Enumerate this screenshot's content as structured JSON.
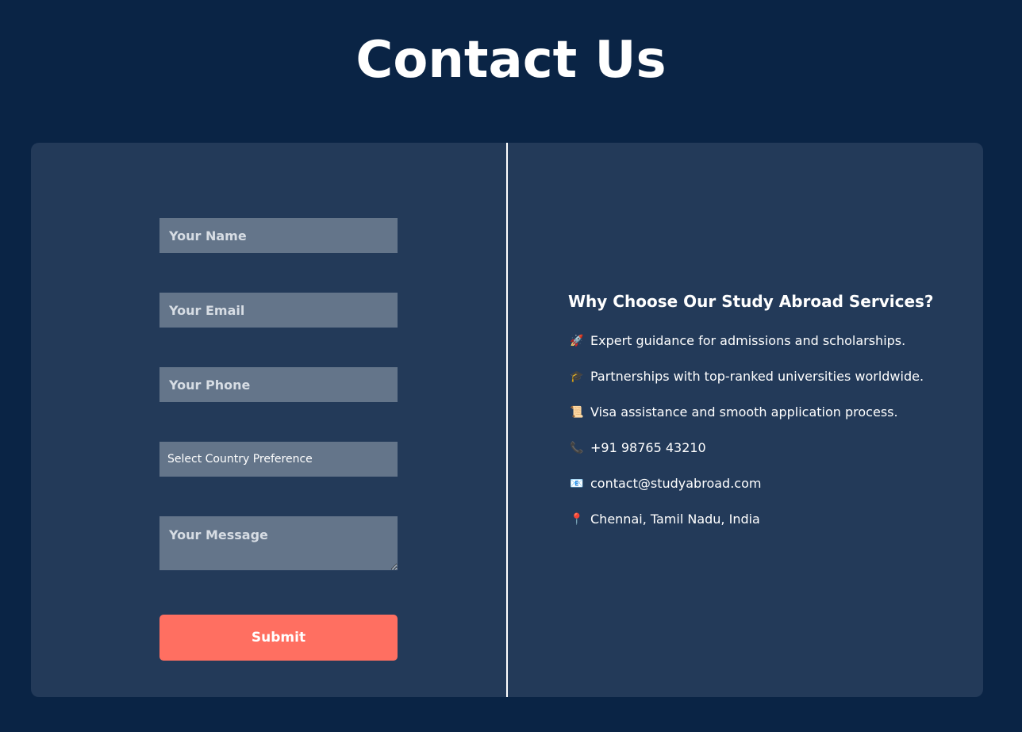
{
  "header": {
    "title": "Contact Us"
  },
  "form": {
    "name_placeholder": "Your Name",
    "email_placeholder": "Your Email",
    "phone_placeholder": "Your Phone",
    "country_select_value": "Select Country Preference",
    "message_placeholder": "Your Message",
    "submit_label": "Submit"
  },
  "info": {
    "heading": "Why Choose Our Study Abroad Services?",
    "items": [
      {
        "icon": "rocket-icon",
        "glyph": "🚀",
        "text": "Expert guidance for admissions and scholarships."
      },
      {
        "icon": "graduation-cap-icon",
        "glyph": "🎓",
        "text": "Partnerships with top-ranked universities worldwide."
      },
      {
        "icon": "scroll-icon",
        "glyph": "📜",
        "text": "Visa assistance and smooth application process."
      },
      {
        "icon": "phone-icon",
        "glyph": "📞",
        "text": "+91 98765 43210"
      },
      {
        "icon": "email-icon",
        "glyph": "📧",
        "text": "contact@studyabroad.com"
      },
      {
        "icon": "location-pin-icon",
        "glyph": "📍",
        "text": "Chennai, Tamil Nadu, India"
      }
    ]
  },
  "colors": {
    "page_background": "#0a2445",
    "card_background": "#233a59",
    "input_background": "#64758a",
    "accent": "#ff6f61",
    "text": "#ffffff"
  }
}
